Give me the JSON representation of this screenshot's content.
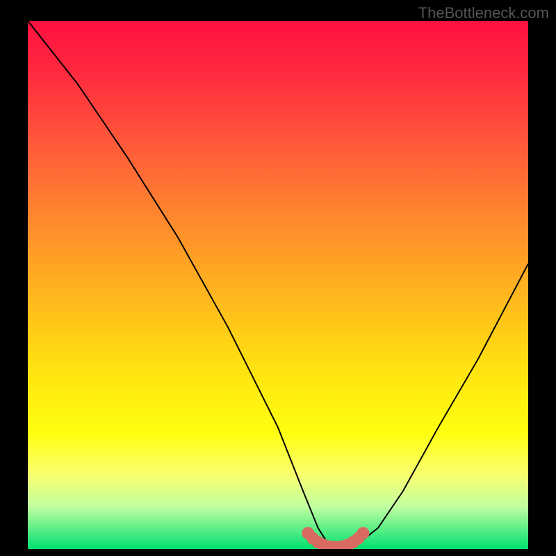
{
  "watermark": "TheBottleneck.com",
  "chart_data": {
    "type": "line",
    "title": "",
    "xlabel": "",
    "ylabel": "",
    "xlim": [
      0,
      100
    ],
    "ylim": [
      0,
      100
    ],
    "series": [
      {
        "name": "curve",
        "x": [
          0,
          10,
          20,
          30,
          40,
          50,
          55,
          58,
          60,
          62,
          66,
          70,
          75,
          82,
          90,
          100
        ],
        "y": [
          100,
          88,
          74,
          59,
          42,
          23,
          11,
          4,
          1,
          0,
          1,
          4,
          11,
          23,
          36,
          54
        ]
      }
    ],
    "markers": [
      {
        "x": 56,
        "y": 3
      },
      {
        "x": 57,
        "y": 2
      },
      {
        "x": 58,
        "y": 1.3
      },
      {
        "x": 59,
        "y": 0.8
      },
      {
        "x": 60,
        "y": 0.5
      },
      {
        "x": 61,
        "y": 0.4
      },
      {
        "x": 62,
        "y": 0.4
      },
      {
        "x": 63,
        "y": 0.5
      },
      {
        "x": 64,
        "y": 0.8
      },
      {
        "x": 65,
        "y": 1.3
      },
      {
        "x": 66,
        "y": 2
      },
      {
        "x": 67,
        "y": 3
      }
    ],
    "colors": {
      "curve": "#000000",
      "markers": "#d96a5f"
    }
  }
}
